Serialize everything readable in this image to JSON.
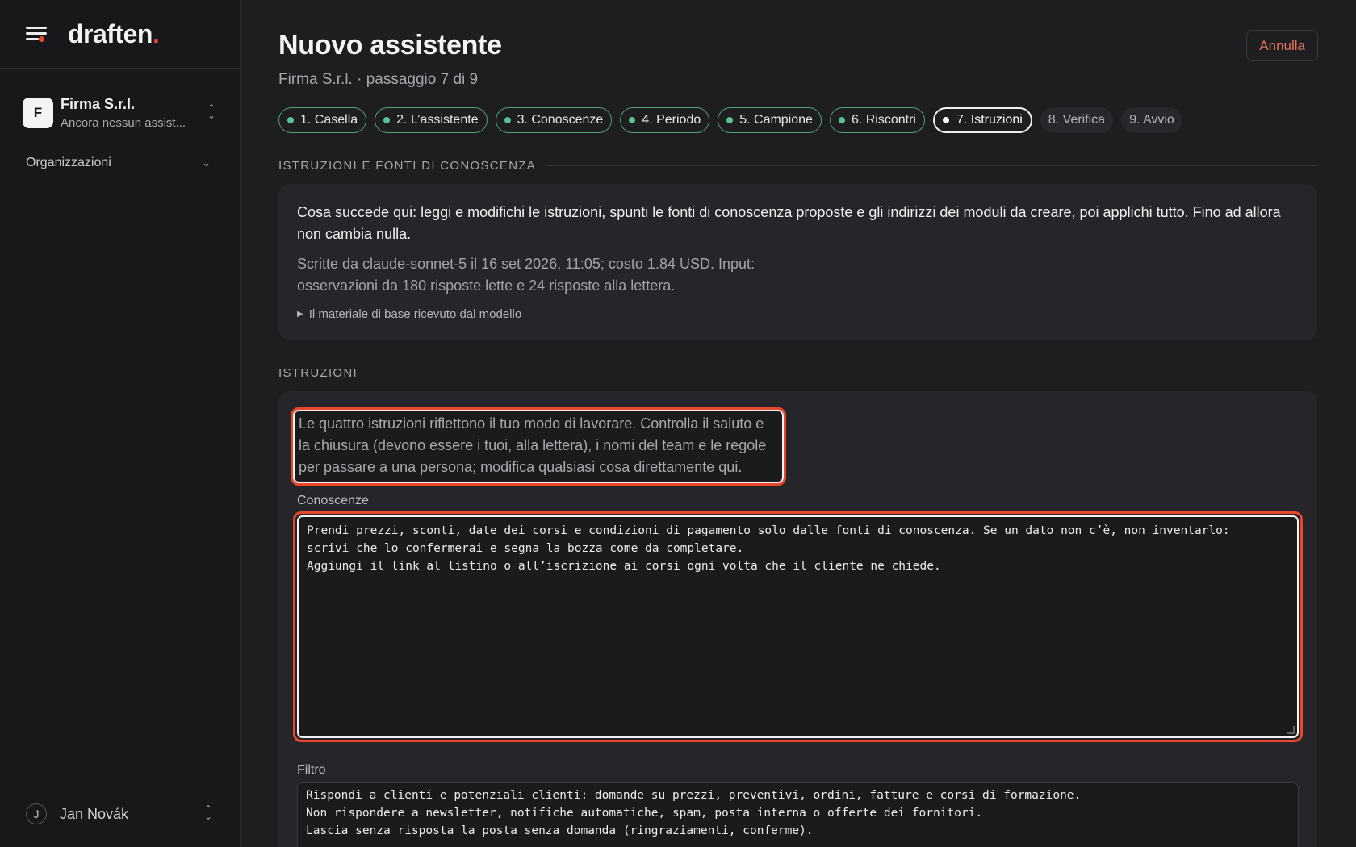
{
  "app": {
    "logo_text": "draften",
    "logo_dot": "."
  },
  "sidebar": {
    "org": {
      "initial": "F",
      "name": "Firma S.r.l.",
      "subtitle": "Ancora nessun assist..."
    },
    "organizations_label": "Organizzazioni",
    "user": {
      "initial": "J",
      "name": "Jan Novák"
    }
  },
  "header": {
    "title": "Nuovo assistente",
    "subtitle": "Firma S.r.l. · passaggio 7 di 9",
    "cancel_label": "Annulla"
  },
  "steps": [
    {
      "label": "1. Casella",
      "state": "done"
    },
    {
      "label": "2. L’assistente",
      "state": "done"
    },
    {
      "label": "3. Conoscenze",
      "state": "done"
    },
    {
      "label": "4. Periodo",
      "state": "done"
    },
    {
      "label": "5. Campione",
      "state": "done"
    },
    {
      "label": "6. Riscontri",
      "state": "done"
    },
    {
      "label": "7. Istruzioni",
      "state": "current"
    },
    {
      "label": "8. Verifica",
      "state": "todo"
    },
    {
      "label": "9. Avvio",
      "state": "todo"
    }
  ],
  "sources_section": {
    "heading": "ISTRUZIONI E FONTI DI CONOSCENZA",
    "description": "Cosa succede qui: leggi e modifichi le istruzioni, spunti le fonti di conoscenza proposte e gli indirizzi dei moduli da creare, poi applichi tutto. Fino ad allora non cambia nulla.",
    "meta_line1": "Scritte da claude-sonnet-5 il 16 set 2026, 11:05; costo 1.84 USD. Input:",
    "meta_line2": "osservazioni da 180 risposte lette e 24 risposte alla lettera.",
    "toggle_label": "Il materiale di base ricevuto dal modello"
  },
  "instructions_section": {
    "heading": "ISTRUZIONI",
    "intro": "Le quattro istruzioni riflettono il tuo modo di lavorare. Controlla il saluto e la chiusura (devono essere i tuoi, alla lettera), i nomi del team e le regole per passare a una persona; modifica qualsiasi cosa direttamente qui.",
    "knowledge_label": "Conoscenze",
    "knowledge_value": "Prendi prezzi, sconti, date dei corsi e condizioni di pagamento solo dalle fonti di conoscenza. Se un dato non c’è, non inventarlo:\nscrivi che lo confermerai e segna la bozza come da completare.\nAggiungi il link al listino o all’iscrizione ai corsi ogni volta che il cliente ne chiede.",
    "filter_label": "Filtro",
    "filter_value": "Rispondi a clienti e potenziali clienti: domande su prezzi, preventivi, ordini, fatture e corsi di formazione.\nNon rispondere a newsletter, notifiche automatiche, spam, posta interna o offerte dei fornitori.\nLascia senza risposta la posta senza domanda (ringraziamenti, conferme)."
  },
  "colors": {
    "accent": "#e8472c",
    "done_dot": "#58c296",
    "background": "#1e1e21",
    "sidebar": "#18181a"
  }
}
